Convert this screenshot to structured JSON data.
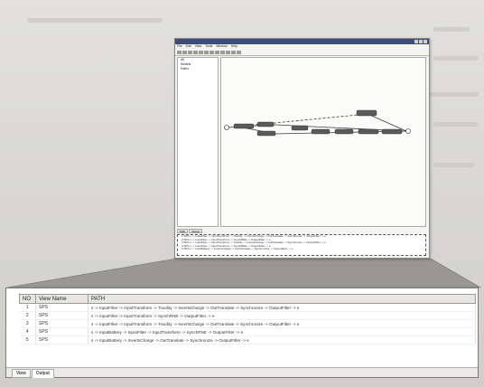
{
  "window": {
    "menu": [
      "File",
      "Edit",
      "View",
      "Tools",
      "Window",
      "Help"
    ],
    "tree_items": [
      "All",
      "Models",
      "Paths"
    ],
    "tabs": [
      "Path",
      "Output"
    ],
    "output_lines": [
      "1  SPS   s -> InputFilter -> InputTransform -> Tracility -> InvertsCharge -> OutTranslate -> Synchronize -> OutputFilter -> e",
      "2  SPS   s -> InputFilter -> InputTransform -> SynchRNE -> OutputFilter -> e",
      "3  SPS   s -> InputFilter -> InputTransform -> Tracility -> InvertsCharge -> OutTranslate -> Synchronize -> OutputFilter -> e",
      "4  SPS   s -> InputFilter -> InputTransform -> SynchRNE -> OutputFilter -> e",
      "5  SPS   s -> InputBattery -> InvertsCharge -> OutTranslate -> Synchronize -> OutputFilter -> e"
    ]
  },
  "table": {
    "headers": [
      "NO",
      "View Name",
      "PATH"
    ],
    "rows": [
      {
        "no": "1",
        "view": "SPS",
        "path": "s -> InputFilter -> InputTransform -> Tracility -> InvertsCharge -> OutTranslate -> Synchronize -> OutputFilter -> e"
      },
      {
        "no": "2",
        "view": "SPS",
        "path": "s -> InputFilter -> InputTransform -> SynchRNE -> OutputFilter -> e"
      },
      {
        "no": "3",
        "view": "SPS",
        "path": "s -> InputFilter -> InputTransform -> Tracility -> InvertsCharge -> OutTranslate -> Synchronize -> OutputFilter -> e"
      },
      {
        "no": "4",
        "view": "SPS",
        "path": "s -> InputBattery -> InputFilter -> InputTransform -> SynchRNE -> OutputFilter -> e"
      },
      {
        "no": "5",
        "view": "SPS",
        "path": "s -> InputBattery -> InvertsCharge -> OutTranslate -> Synchronize -> OutputFilter -> e"
      }
    ],
    "tabs": [
      "View",
      "Output"
    ]
  },
  "colors": {
    "titlebar": "#3e4c7a",
    "node": "#5a5a5a",
    "border": "#7c7c78"
  }
}
